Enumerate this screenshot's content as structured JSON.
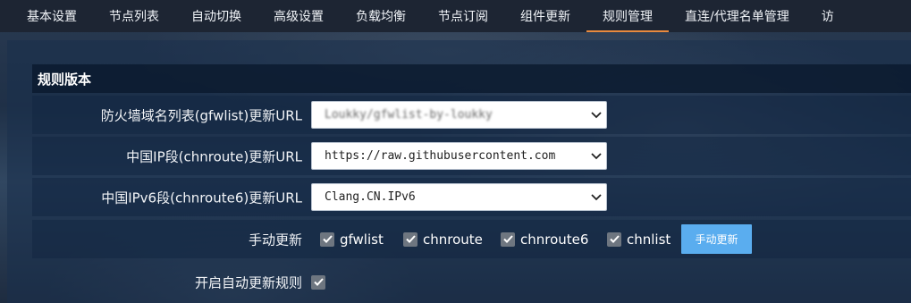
{
  "nav": {
    "tabs": [
      {
        "label": "基本设置"
      },
      {
        "label": "节点列表"
      },
      {
        "label": "自动切换"
      },
      {
        "label": "高级设置"
      },
      {
        "label": "负载均衡"
      },
      {
        "label": "节点订阅"
      },
      {
        "label": "组件更新"
      },
      {
        "label": "规则管理"
      },
      {
        "label": "直连/代理名单管理"
      },
      {
        "label": "访"
      }
    ],
    "active_tab": "规则管理"
  },
  "section": {
    "title": "规则版本"
  },
  "rules": {
    "gfwlist": {
      "label": "防火墙域名列表(gfwlist)更新URL",
      "value": "Loukky/gfwlist-by-loukky"
    },
    "chnroute": {
      "label": "中国IP段(chnroute)更新URL",
      "value": "https://raw.githubusercontent.com"
    },
    "chnroute6": {
      "label": "中国IPv6段(chnroute6)更新URL",
      "value": "Clang.CN.IPv6"
    }
  },
  "manual_update": {
    "label": "手动更新",
    "options": [
      {
        "label": "gfwlist",
        "checked": true
      },
      {
        "label": "chnroute",
        "checked": true
      },
      {
        "label": "chnroute6",
        "checked": true
      },
      {
        "label": "chnlist",
        "checked": true
      }
    ],
    "button": "手动更新"
  },
  "auto_update": {
    "label": "开启自动更新规则",
    "checked": true
  },
  "colors": {
    "accent": "#e98a3e",
    "button": "#5aadef",
    "nav_bg": "#1d2533"
  }
}
